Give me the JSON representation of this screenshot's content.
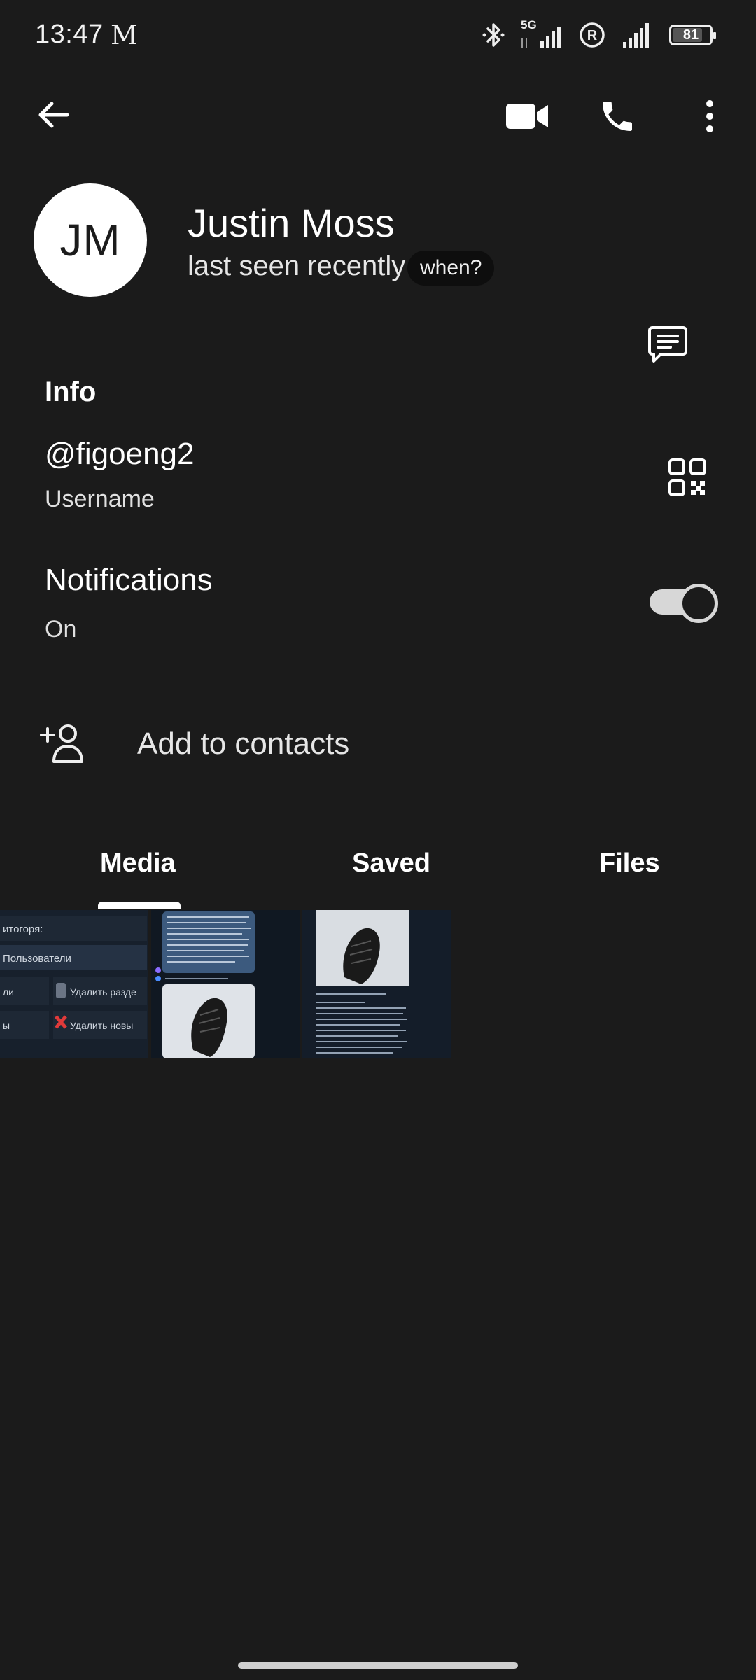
{
  "status_bar": {
    "time": "13:47",
    "carrier_glyph": "M",
    "network": "5G",
    "battery": "81",
    "battery_level_percent": 81
  },
  "top_bar": {
    "icons": [
      "back-arrow-icon",
      "video-call-icon",
      "phone-icon",
      "more-vertical-icon"
    ]
  },
  "profile": {
    "initials": "JM",
    "name": "Justin Moss",
    "last_seen": "last seen recently",
    "when_label": "when?"
  },
  "info": {
    "section_title": "Info",
    "username": "@figoeng2",
    "username_label": "Username",
    "notifications_title": "Notifications",
    "notifications_value": "On",
    "notifications_enabled": true
  },
  "actions": {
    "add_to_contacts": "Add to contacts"
  },
  "tabs": [
    {
      "label": "Media",
      "active": true
    },
    {
      "label": "Saved",
      "active": false
    },
    {
      "label": "Files",
      "active": false
    }
  ],
  "media": {
    "thumb1_lines": [
      "итогоря:",
      "Пользователи",
      "ли",
      "Удалить разде",
      "ы",
      "Удалить новы"
    ]
  },
  "colors": {
    "background": "#1b1b1b",
    "avatar_bg": "#ffffff",
    "toggle_on": "#d7d7d7",
    "chip_bg": "#0e0e0e"
  }
}
